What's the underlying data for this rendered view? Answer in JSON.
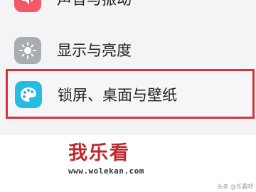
{
  "settings": {
    "items": [
      {
        "label": "声音与振动",
        "icon": "speaker-icon",
        "color": "#f5586b"
      },
      {
        "label": "显示与亮度",
        "icon": "sun-brightness-icon",
        "color": "#a9acb3"
      },
      {
        "label": "锁屏、桌面与壁纸",
        "icon": "palette-icon",
        "color": "#22bde0"
      }
    ],
    "highlight_color": "#d8333a"
  },
  "watermark": {
    "main": "我乐看",
    "url": "www.wolekan.com",
    "color": "#c1272d"
  },
  "credit": {
    "text": "头条 @乐看吧"
  }
}
